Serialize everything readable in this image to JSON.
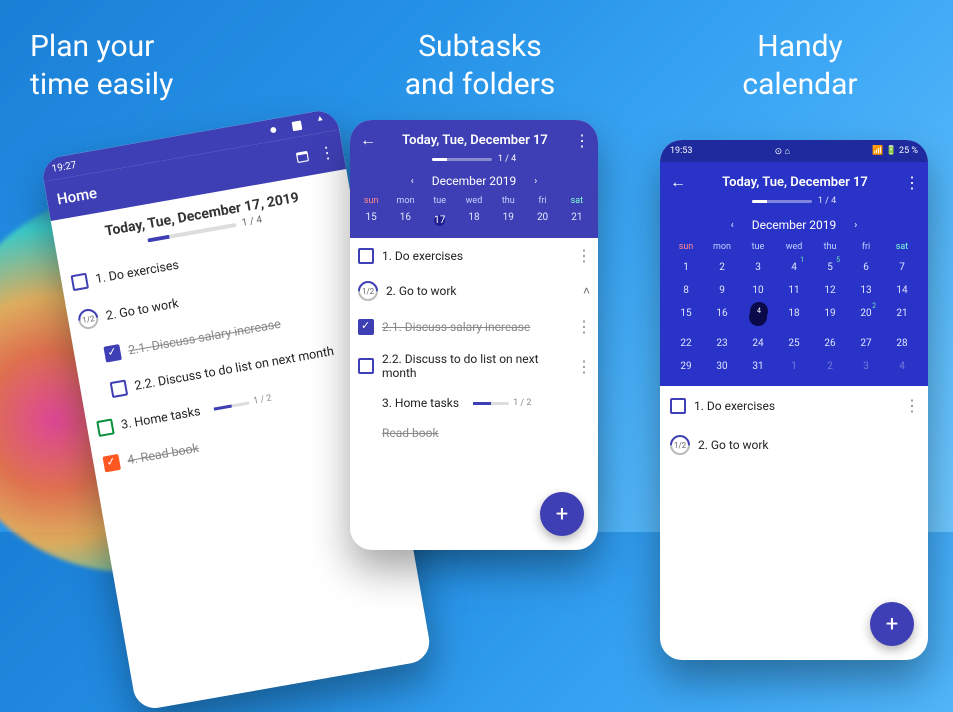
{
  "captions": {
    "c1a": "Plan your",
    "c1b": "time easily",
    "c2a": "Subtasks",
    "c2b": "and folders",
    "c3a": "Handy",
    "c3b": "calendar"
  },
  "phone1": {
    "time": "19:27",
    "appbar_title": "Home",
    "date_header": "Today, Tue, December 17, 2019",
    "progress_label": "1 / 4",
    "tasks": {
      "t1": "1. Do exercises",
      "t2": "2. Go to work",
      "t2_circ": "1/2",
      "t21": "2.1. Discuss salary increase",
      "t22": "2.2. Discuss to do list on next month",
      "t3": "3. Home tasks",
      "t3_prog": "1 / 2",
      "t4": "4. Read book"
    }
  },
  "phone2": {
    "title": "Today, Tue, December 17",
    "progress_label": "1 / 4",
    "month_label": "December 2019",
    "dow": {
      "sun": "sun",
      "mon": "mon",
      "tue": "tue",
      "wed": "wed",
      "thu": "thu",
      "fri": "fri",
      "sat": "sat"
    },
    "week": {
      "d15": "15",
      "d16": "16",
      "d17": "17",
      "d18": "18",
      "d19": "19",
      "d20": "20",
      "d21": "21"
    },
    "tasks": {
      "t1": "1. Do exercises",
      "t2": "2. Go to work",
      "t2_circ": "1/2",
      "t21": "2.1. Discuss salary increase",
      "t22": "2.2. Discuss to do list on next month",
      "t3": "3. Home tasks",
      "t3_prog": "1 / 2",
      "t4": "Read book",
      "under_txt": "on next"
    }
  },
  "phone3": {
    "time": "19:53",
    "battery": "25 %",
    "title": "Today, Tue, December 17",
    "progress_label": "1 / 4",
    "month_label": "December 2019",
    "dow": {
      "sun": "sun",
      "mon": "mon",
      "tue": "tue",
      "wed": "wed",
      "thu": "thu",
      "fri": "fri",
      "sat": "sat"
    },
    "days": [
      {
        "n": "1",
        "f": false
      },
      {
        "n": "2",
        "f": false
      },
      {
        "n": "3",
        "f": false
      },
      {
        "n": "4",
        "f": false,
        "b": "1"
      },
      {
        "n": "5",
        "f": false,
        "b": "5"
      },
      {
        "n": "6",
        "f": false
      },
      {
        "n": "7",
        "f": false
      },
      {
        "n": "8",
        "f": false
      },
      {
        "n": "9",
        "f": false
      },
      {
        "n": "10",
        "f": false
      },
      {
        "n": "11",
        "f": false
      },
      {
        "n": "12",
        "f": false
      },
      {
        "n": "13",
        "f": false
      },
      {
        "n": "14",
        "f": false
      },
      {
        "n": "15",
        "f": false
      },
      {
        "n": "16",
        "f": false
      },
      {
        "n": "17",
        "f": false,
        "today": true,
        "b": "4"
      },
      {
        "n": "18",
        "f": false
      },
      {
        "n": "19",
        "f": false
      },
      {
        "n": "20",
        "f": false,
        "b": "2"
      },
      {
        "n": "21",
        "f": false
      },
      {
        "n": "22",
        "f": false
      },
      {
        "n": "23",
        "f": false
      },
      {
        "n": "24",
        "f": false
      },
      {
        "n": "25",
        "f": false
      },
      {
        "n": "26",
        "f": false
      },
      {
        "n": "27",
        "f": false
      },
      {
        "n": "28",
        "f": false
      },
      {
        "n": "29",
        "f": false
      },
      {
        "n": "30",
        "f": false
      },
      {
        "n": "31",
        "f": false
      },
      {
        "n": "1",
        "f": true
      },
      {
        "n": "2",
        "f": true
      },
      {
        "n": "3",
        "f": true
      },
      {
        "n": "4",
        "f": true
      }
    ],
    "tasks": {
      "t1": "1. Do exercises",
      "t2": "2. Go to work",
      "t2_circ": "1/2"
    }
  }
}
